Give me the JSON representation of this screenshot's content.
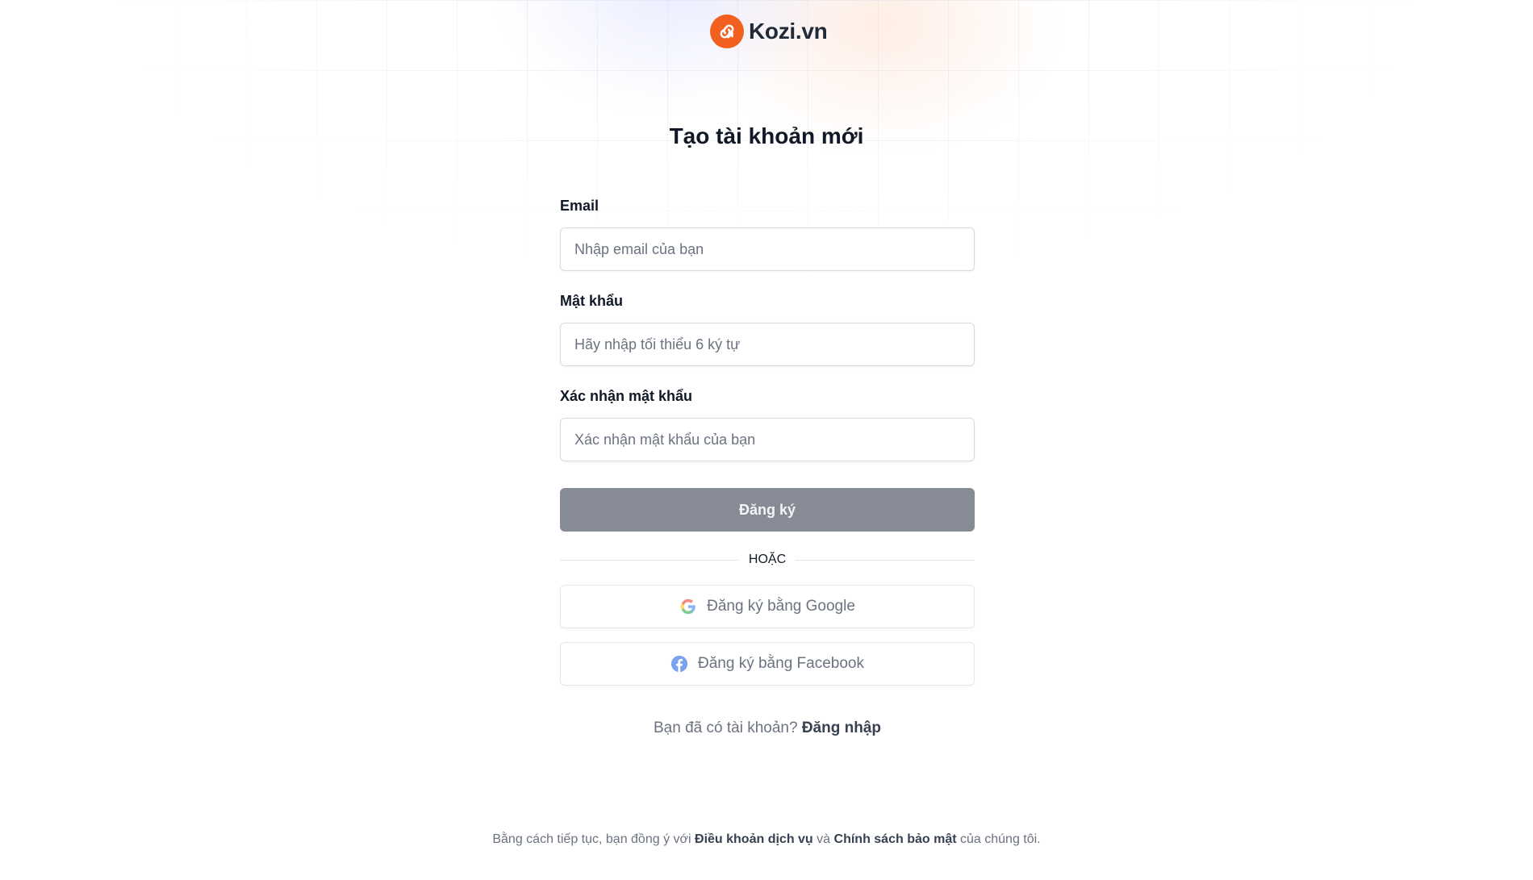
{
  "brand": {
    "name": "Kozi.vn",
    "accent_color": "#f2601f",
    "logo_icon": "link-arrow-icon"
  },
  "title": "Tạo tài khoản mới",
  "form": {
    "email": {
      "label": "Email",
      "placeholder": "Nhập email của bạn",
      "value": ""
    },
    "password": {
      "label": "Mật khẩu",
      "placeholder": "Hãy nhập tối thiểu 6 ký tự",
      "value": ""
    },
    "confirm_password": {
      "label": "Xác nhận mật khẩu",
      "placeholder": "Xác nhận mật khẩu của bạn",
      "value": ""
    },
    "submit_label": "Đăng ký",
    "submit_color": "#868b95"
  },
  "divider_text": "HOẶC",
  "social": {
    "google": {
      "label": "Đăng ký bằng Google",
      "icon": "google-icon"
    },
    "facebook": {
      "label": "Đăng ký bằng Facebook",
      "icon": "facebook-icon"
    }
  },
  "login": {
    "prompt": "Bạn đã có tài khoản?",
    "link_label": "Đăng nhập"
  },
  "footer": {
    "prefix": "Bằng cách tiếp tục, bạn đồng ý với",
    "terms_label": "Điều khoản dịch vụ",
    "conjunction": "và",
    "privacy_label": "Chính sách bảo mật",
    "suffix": "của chúng tôi."
  }
}
